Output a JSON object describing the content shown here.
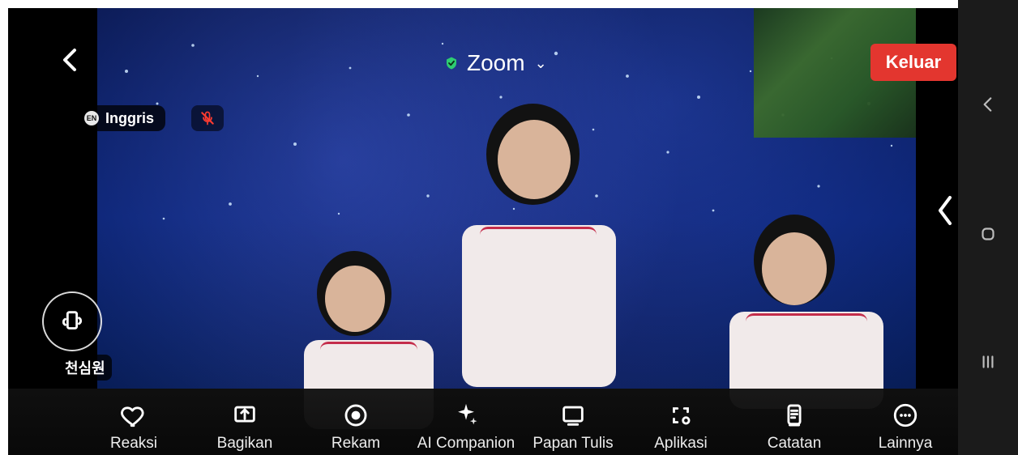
{
  "app": {
    "title": "Zoom",
    "leave_label": "Keluar",
    "language_label": "Inggris",
    "language_badge": "EN",
    "participant_name": "천심원"
  },
  "toolbar": {
    "items": [
      {
        "label": "Reaksi",
        "icon": "heart-icon"
      },
      {
        "label": "Bagikan",
        "icon": "share-screen-icon"
      },
      {
        "label": "Rekam",
        "icon": "record-icon"
      },
      {
        "label": "AI Companion",
        "icon": "sparkle-icon"
      },
      {
        "label": "Papan Tulis",
        "icon": "whiteboard-icon"
      },
      {
        "label": "Aplikasi",
        "icon": "apps-icon"
      },
      {
        "label": "Catatan",
        "icon": "notes-icon"
      },
      {
        "label": "Lainnya",
        "icon": "more-icon"
      }
    ]
  },
  "colors": {
    "leave_red": "#e3362f",
    "shield_green": "#2ecc71",
    "toolbar_bg": "#121212",
    "system_nav_bg": "#1b1b1b"
  }
}
